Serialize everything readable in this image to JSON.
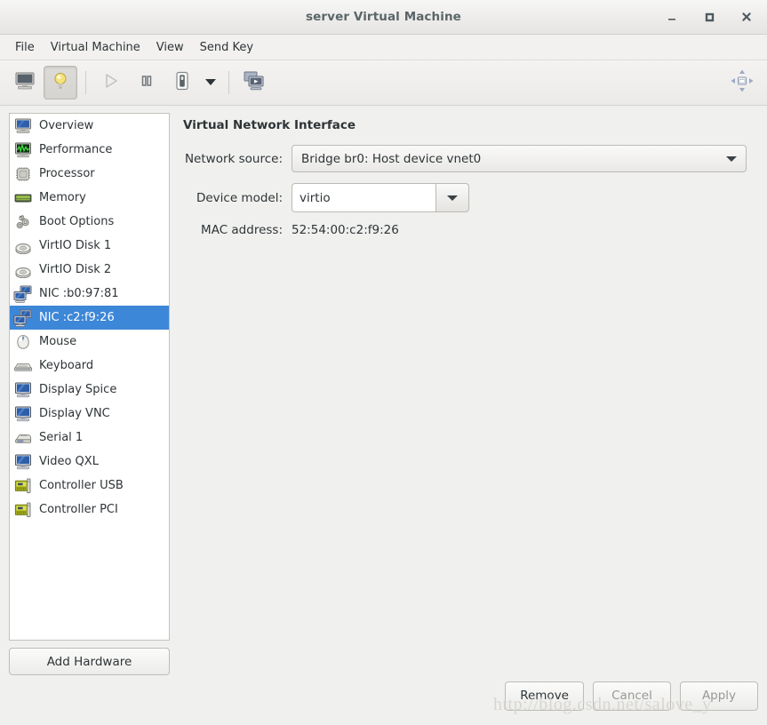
{
  "window": {
    "title": "server Virtual Machine",
    "controls": [
      {
        "name": "minimize",
        "glyph": "minimize-icon"
      },
      {
        "name": "maximize",
        "glyph": "maximize-icon"
      },
      {
        "name": "close",
        "glyph": "close-icon"
      }
    ]
  },
  "menubar": {
    "items": [
      {
        "label": "File"
      },
      {
        "label": "Virtual Machine"
      },
      {
        "label": "View"
      },
      {
        "label": "Send Key"
      }
    ]
  },
  "toolbar": {
    "buttons": [
      {
        "name": "show-console-button",
        "icon": "monitor-icon",
        "pressed": false,
        "enabled": true
      },
      {
        "name": "show-details-button",
        "icon": "lightbulb-icon",
        "pressed": true,
        "enabled": true
      },
      {
        "name": "run-button",
        "icon": "play-icon",
        "pressed": false,
        "enabled": false
      },
      {
        "name": "pause-button",
        "icon": "pause-icon",
        "pressed": false,
        "enabled": true
      },
      {
        "name": "shutdown-button",
        "icon": "power-icon",
        "pressed": false,
        "enabled": true
      },
      {
        "name": "shutdown-menu-button",
        "icon": "chevron-down-icon",
        "pressed": false,
        "enabled": true
      },
      {
        "name": "snapshots-button",
        "icon": "snapshots-icon",
        "pressed": false,
        "enabled": true
      }
    ],
    "fullscreen": {
      "name": "fullscreen-button",
      "icon": "fullscreen-icon"
    }
  },
  "sidebar": {
    "items": [
      {
        "label": "Overview",
        "icon": "monitor-icon",
        "selected": false
      },
      {
        "label": "Performance",
        "icon": "graph-icon",
        "selected": false
      },
      {
        "label": "Processor",
        "icon": "cpu-icon",
        "selected": false
      },
      {
        "label": "Memory",
        "icon": "memory-icon",
        "selected": false
      },
      {
        "label": "Boot Options",
        "icon": "gears-icon",
        "selected": false
      },
      {
        "label": "VirtIO Disk 1",
        "icon": "disk-icon",
        "selected": false
      },
      {
        "label": "VirtIO Disk 2",
        "icon": "disk-icon",
        "selected": false
      },
      {
        "label": "NIC :b0:97:81",
        "icon": "network-icon",
        "selected": false
      },
      {
        "label": "NIC :c2:f9:26",
        "icon": "network-icon",
        "selected": true
      },
      {
        "label": "Mouse",
        "icon": "mouse-icon",
        "selected": false
      },
      {
        "label": "Keyboard",
        "icon": "keyboard-icon",
        "selected": false
      },
      {
        "label": "Display Spice",
        "icon": "display-icon",
        "selected": false
      },
      {
        "label": "Display VNC",
        "icon": "display-icon",
        "selected": false
      },
      {
        "label": "Serial 1",
        "icon": "serial-icon",
        "selected": false
      },
      {
        "label": "Video QXL",
        "icon": "display-icon",
        "selected": false
      },
      {
        "label": "Controller USB",
        "icon": "controller-icon",
        "selected": false
      },
      {
        "label": "Controller PCI",
        "icon": "controller-icon",
        "selected": false
      }
    ],
    "add_hardware_label": "Add Hardware"
  },
  "main": {
    "panel_title": "Virtual Network Interface",
    "network_source": {
      "label": "Network source:",
      "value": "Bridge br0: Host device vnet0"
    },
    "device_model": {
      "label": "Device model:",
      "value": "virtio"
    },
    "mac_address": {
      "label": "MAC address:",
      "value": "52:54:00:c2:f9:26"
    }
  },
  "footer": {
    "remove_label": "Remove",
    "cancel_label": "Cancel",
    "apply_label": "Apply"
  },
  "watermark": {
    "text": "http://blog.csdn.net/salove_y"
  },
  "colors": {
    "selection": "#3d87d8",
    "window_bg": "#f0f0ef",
    "list_bg": "#ffffff",
    "text": "#2e3436"
  }
}
